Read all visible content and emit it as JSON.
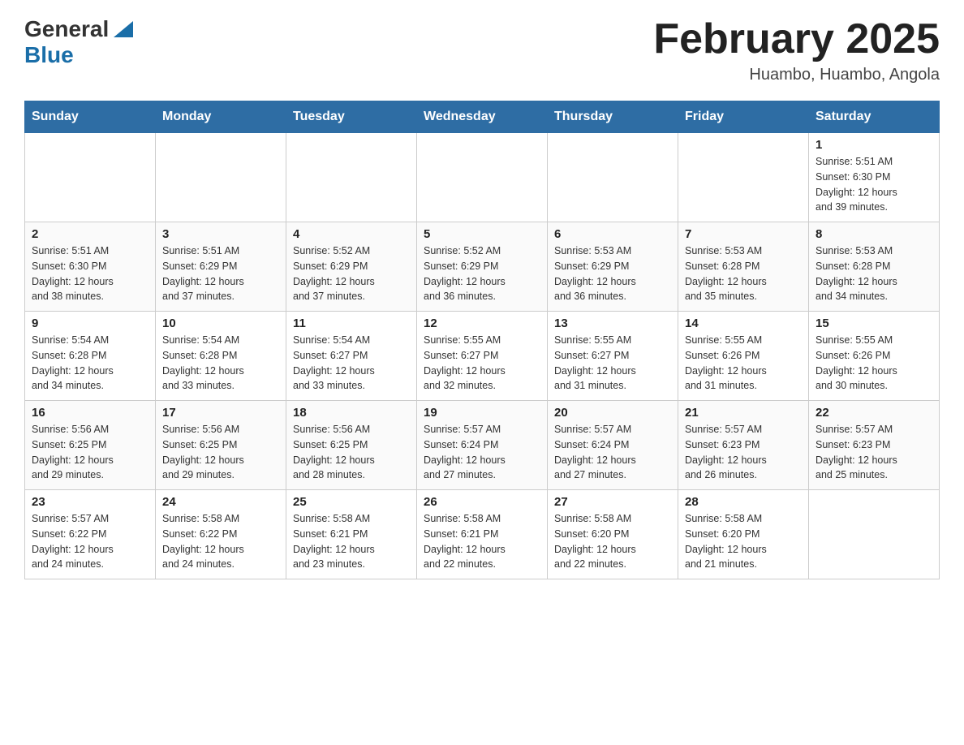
{
  "header": {
    "logo_general": "General",
    "logo_blue": "Blue",
    "title": "February 2025",
    "subtitle": "Huambo, Huambo, Angola"
  },
  "weekdays": [
    "Sunday",
    "Monday",
    "Tuesday",
    "Wednesday",
    "Thursday",
    "Friday",
    "Saturday"
  ],
  "weeks": [
    [
      {
        "day": "",
        "info": ""
      },
      {
        "day": "",
        "info": ""
      },
      {
        "day": "",
        "info": ""
      },
      {
        "day": "",
        "info": ""
      },
      {
        "day": "",
        "info": ""
      },
      {
        "day": "",
        "info": ""
      },
      {
        "day": "1",
        "info": "Sunrise: 5:51 AM\nSunset: 6:30 PM\nDaylight: 12 hours\nand 39 minutes."
      }
    ],
    [
      {
        "day": "2",
        "info": "Sunrise: 5:51 AM\nSunset: 6:30 PM\nDaylight: 12 hours\nand 38 minutes."
      },
      {
        "day": "3",
        "info": "Sunrise: 5:51 AM\nSunset: 6:29 PM\nDaylight: 12 hours\nand 37 minutes."
      },
      {
        "day": "4",
        "info": "Sunrise: 5:52 AM\nSunset: 6:29 PM\nDaylight: 12 hours\nand 37 minutes."
      },
      {
        "day": "5",
        "info": "Sunrise: 5:52 AM\nSunset: 6:29 PM\nDaylight: 12 hours\nand 36 minutes."
      },
      {
        "day": "6",
        "info": "Sunrise: 5:53 AM\nSunset: 6:29 PM\nDaylight: 12 hours\nand 36 minutes."
      },
      {
        "day": "7",
        "info": "Sunrise: 5:53 AM\nSunset: 6:28 PM\nDaylight: 12 hours\nand 35 minutes."
      },
      {
        "day": "8",
        "info": "Sunrise: 5:53 AM\nSunset: 6:28 PM\nDaylight: 12 hours\nand 34 minutes."
      }
    ],
    [
      {
        "day": "9",
        "info": "Sunrise: 5:54 AM\nSunset: 6:28 PM\nDaylight: 12 hours\nand 34 minutes."
      },
      {
        "day": "10",
        "info": "Sunrise: 5:54 AM\nSunset: 6:28 PM\nDaylight: 12 hours\nand 33 minutes."
      },
      {
        "day": "11",
        "info": "Sunrise: 5:54 AM\nSunset: 6:27 PM\nDaylight: 12 hours\nand 33 minutes."
      },
      {
        "day": "12",
        "info": "Sunrise: 5:55 AM\nSunset: 6:27 PM\nDaylight: 12 hours\nand 32 minutes."
      },
      {
        "day": "13",
        "info": "Sunrise: 5:55 AM\nSunset: 6:27 PM\nDaylight: 12 hours\nand 31 minutes."
      },
      {
        "day": "14",
        "info": "Sunrise: 5:55 AM\nSunset: 6:26 PM\nDaylight: 12 hours\nand 31 minutes."
      },
      {
        "day": "15",
        "info": "Sunrise: 5:55 AM\nSunset: 6:26 PM\nDaylight: 12 hours\nand 30 minutes."
      }
    ],
    [
      {
        "day": "16",
        "info": "Sunrise: 5:56 AM\nSunset: 6:25 PM\nDaylight: 12 hours\nand 29 minutes."
      },
      {
        "day": "17",
        "info": "Sunrise: 5:56 AM\nSunset: 6:25 PM\nDaylight: 12 hours\nand 29 minutes."
      },
      {
        "day": "18",
        "info": "Sunrise: 5:56 AM\nSunset: 6:25 PM\nDaylight: 12 hours\nand 28 minutes."
      },
      {
        "day": "19",
        "info": "Sunrise: 5:57 AM\nSunset: 6:24 PM\nDaylight: 12 hours\nand 27 minutes."
      },
      {
        "day": "20",
        "info": "Sunrise: 5:57 AM\nSunset: 6:24 PM\nDaylight: 12 hours\nand 27 minutes."
      },
      {
        "day": "21",
        "info": "Sunrise: 5:57 AM\nSunset: 6:23 PM\nDaylight: 12 hours\nand 26 minutes."
      },
      {
        "day": "22",
        "info": "Sunrise: 5:57 AM\nSunset: 6:23 PM\nDaylight: 12 hours\nand 25 minutes."
      }
    ],
    [
      {
        "day": "23",
        "info": "Sunrise: 5:57 AM\nSunset: 6:22 PM\nDaylight: 12 hours\nand 24 minutes."
      },
      {
        "day": "24",
        "info": "Sunrise: 5:58 AM\nSunset: 6:22 PM\nDaylight: 12 hours\nand 24 minutes."
      },
      {
        "day": "25",
        "info": "Sunrise: 5:58 AM\nSunset: 6:21 PM\nDaylight: 12 hours\nand 23 minutes."
      },
      {
        "day": "26",
        "info": "Sunrise: 5:58 AM\nSunset: 6:21 PM\nDaylight: 12 hours\nand 22 minutes."
      },
      {
        "day": "27",
        "info": "Sunrise: 5:58 AM\nSunset: 6:20 PM\nDaylight: 12 hours\nand 22 minutes."
      },
      {
        "day": "28",
        "info": "Sunrise: 5:58 AM\nSunset: 6:20 PM\nDaylight: 12 hours\nand 21 minutes."
      },
      {
        "day": "",
        "info": ""
      }
    ]
  ]
}
